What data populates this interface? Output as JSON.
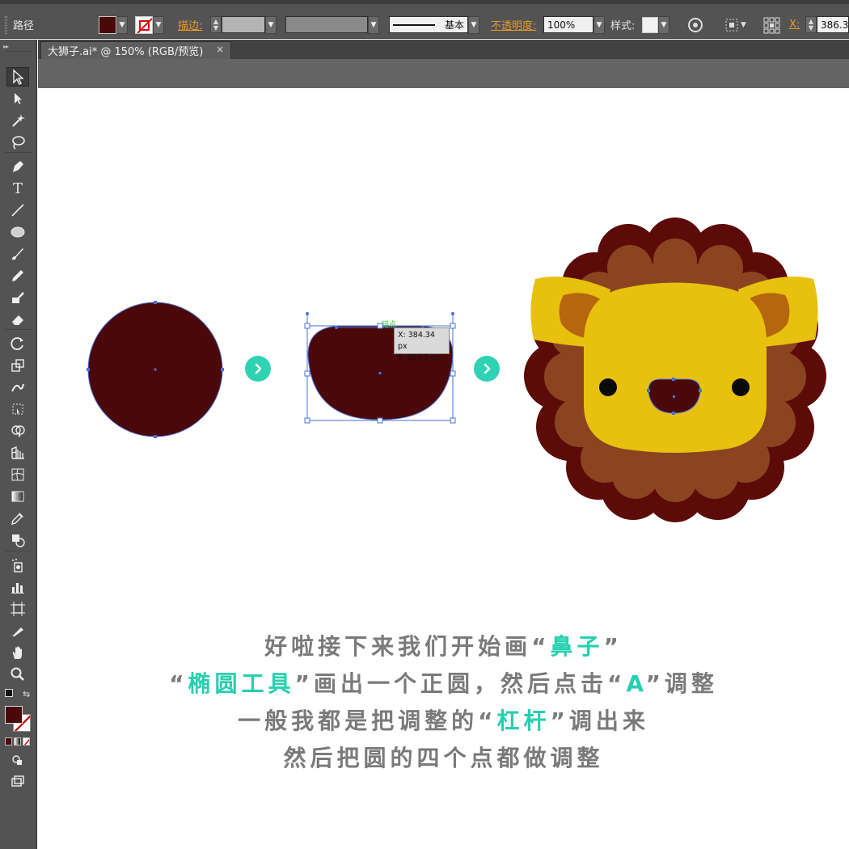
{
  "control_bar": {
    "path_label": "路径",
    "stroke_label": "描边:",
    "stroke_profile_label": "基本",
    "opacity_label": "不透明度:",
    "opacity_value": "100%",
    "style_label": "样式:",
    "x_label": "X:",
    "x_value": "386.3",
    "fill_color": "#4a0808",
    "stroke_color": "#ffffff"
  },
  "document_tab": {
    "title": "大狮子.ai* @ 150% (RGB/预览)",
    "close_glyph": "×"
  },
  "tools": [
    "selection-tool",
    "direct-selection-tool",
    "magic-wand-tool",
    "lasso-tool",
    "pen-tool",
    "type-tool",
    "line-tool",
    "ellipse-tool",
    "paintbrush-tool",
    "pencil-tool",
    "blob-brush-tool",
    "eraser-tool",
    "rotate-tool",
    "scale-tool",
    "warp-tool",
    "free-transform-tool",
    "shape-builder-tool",
    "perspective-grid-tool",
    "mesh-tool",
    "gradient-tool",
    "eyedropper-tool",
    "blend-tool",
    "symbol-sprayer-tool",
    "column-graph-tool",
    "artboard-tool",
    "slice-tool",
    "hand-tool",
    "zoom-tool"
  ],
  "canvas": {
    "anchor_hint": "锚点",
    "tooltip_x": "X: 384.34 px",
    "tooltip_y": "Y: 353.2 px",
    "nose_color": "#4a0808",
    "selection_color": "#4a6fd6",
    "arrow_color": "#2fd3b3",
    "lion": {
      "mane_outline_color": "#5c0b09",
      "mane_color": "#8a4520",
      "face_color": "#e8c10f",
      "inner_ear_color": "#b5660f",
      "eye_color": "#0a0a0a"
    }
  },
  "instructions": {
    "line1": {
      "a": "好啦接下来我们开始画",
      "q1": "“",
      "hl": "鼻子",
      "q2": "”"
    },
    "line2": {
      "q1": "“",
      "hl": "椭圆工具",
      "q2": "”",
      "b": "画出一个正圆，然后点击",
      "q3": "“",
      "hl2": "A",
      "q4": "”",
      "c": "调整"
    },
    "line3": {
      "a": "一般我都是把调整的",
      "q1": "“",
      "hl": "杠杆",
      "q2": "”",
      "b": "调出来"
    },
    "line4": {
      "a": "然后把圆的四个点都做调整"
    }
  }
}
